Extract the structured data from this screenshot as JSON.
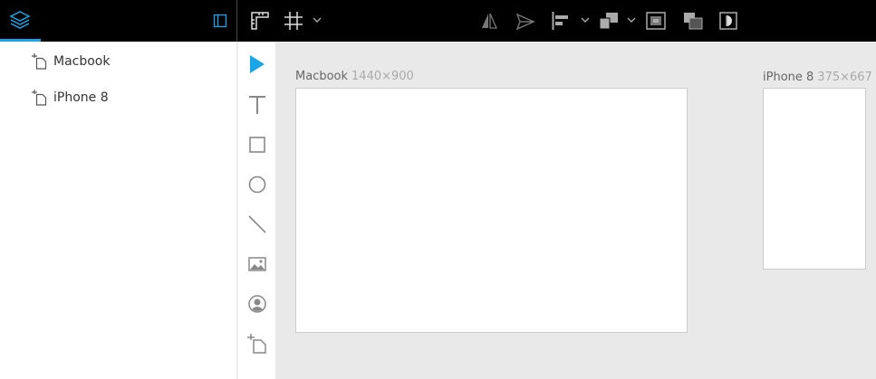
{
  "toolbar": {
    "icons": [
      "layers-icon",
      "panel-toggle-icon",
      "ruler-icon",
      "grid-icon",
      "chevron-down-icon",
      "flip-icon",
      "send-icon",
      "align-left-icon",
      "chevron-down-icon",
      "arrange-icon",
      "chevron-down-icon",
      "frame-icon",
      "mask-icon",
      "contrast-icon"
    ]
  },
  "sidebar": {
    "items": [
      {
        "label": "Macbook"
      },
      {
        "label": "iPhone 8"
      }
    ]
  },
  "tools": [
    "select-tool",
    "text-tool",
    "rectangle-tool",
    "ellipse-tool",
    "line-tool",
    "image-tool",
    "avatar-tool",
    "artboard-tool"
  ],
  "canvas": {
    "artboards": [
      {
        "name": "Macbook",
        "dims": "1440×900"
      },
      {
        "name": "iPhone 8",
        "dims": "375×667"
      }
    ]
  },
  "colors": {
    "accent": "#1aa6e6",
    "toolbar_bg": "#000000",
    "canvas_bg": "#e9e9e9"
  }
}
